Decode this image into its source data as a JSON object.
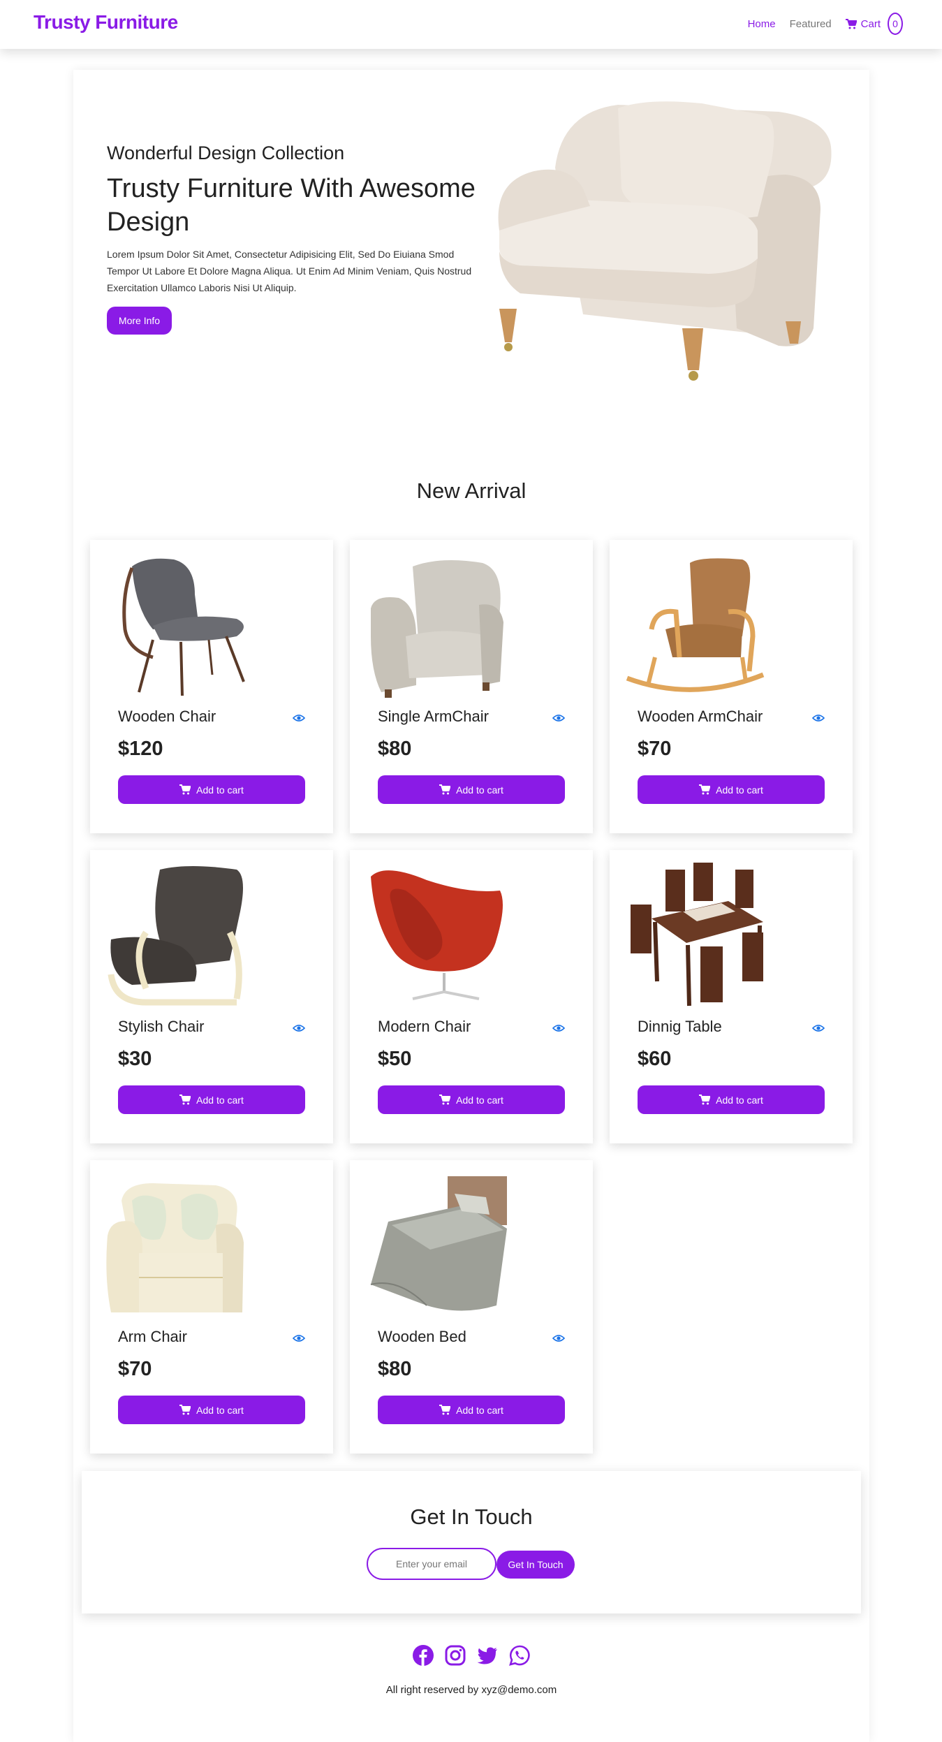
{
  "nav": {
    "brand": "Trusty Furniture",
    "links": [
      {
        "label": "Home",
        "active": true
      },
      {
        "label": "Featured",
        "active": false
      }
    ],
    "cart_label": "Cart",
    "cart_count": "0"
  },
  "hero": {
    "subtitle": "Wonderful Design Collection",
    "title": "Trusty Furniture With Awesome Design",
    "text": "Lorem Ipsum Dolor Sit Amet, Consectetur Adipisicing Elit, Sed Do Eiuiana Smod Tempor Ut Labore Et Dolore Magna Aliqua. Ut Enim Ad Minim Veniam, Quis Nostrud Exercitation Ullamco Laboris Nisi Ut Aliquip.",
    "button": "More Info"
  },
  "new_arrival": {
    "title": "New Arrival",
    "add_to_cart_label": "Add to cart",
    "products": [
      {
        "name": "Wooden Chair",
        "price": "$120"
      },
      {
        "name": "Single ArmChair",
        "price": "$80"
      },
      {
        "name": "Wooden ArmChair",
        "price": "$70"
      },
      {
        "name": "Stylish Chair",
        "price": "$30"
      },
      {
        "name": "Modern Chair",
        "price": "$50"
      },
      {
        "name": "Dinnig Table",
        "price": "$60"
      },
      {
        "name": "Arm Chair",
        "price": "$70"
      },
      {
        "name": "Wooden Bed",
        "price": "$80"
      }
    ]
  },
  "contact": {
    "title": "Get In Touch",
    "placeholder": "Enter your email",
    "button": "Get In Touch"
  },
  "footer": {
    "socials": [
      "facebook-icon",
      "instagram-icon",
      "twitter-icon",
      "whatsapp-icon"
    ],
    "copyright": "All right reserved by xyz@demo.com"
  },
  "colors": {
    "accent": "#8a1be6",
    "eye": "#1a73e8"
  }
}
